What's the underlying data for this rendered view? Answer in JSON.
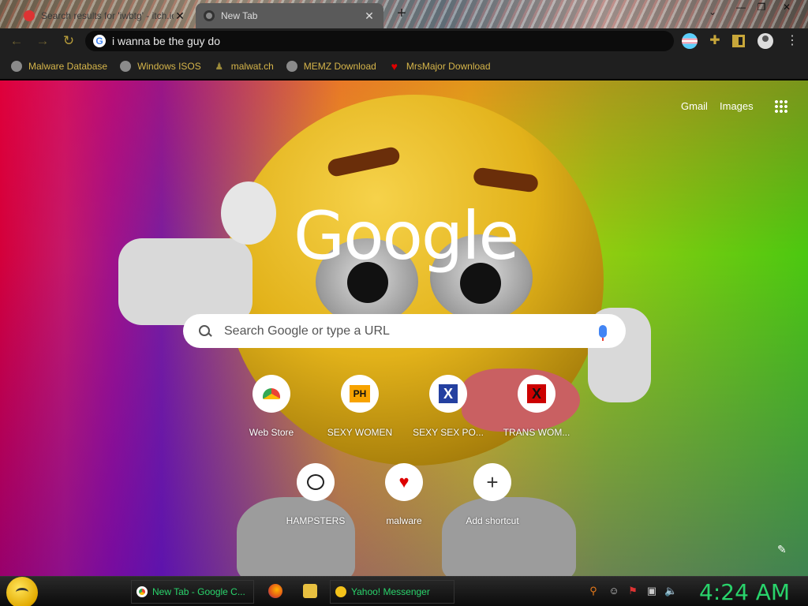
{
  "browser": {
    "tabs": [
      {
        "title": "Search results for 'iwbtg' - itch.io",
        "close": "✕"
      },
      {
        "title": "New Tab",
        "close": "✕"
      }
    ],
    "new_tab_symbol": "+",
    "window_controls": {
      "minimize": "—",
      "restore": "❐",
      "close": "✕"
    },
    "tab_search_symbol": "⌄",
    "toolbar": {
      "back": "←",
      "forward": "→",
      "reload": "↻",
      "address": "i wanna be the guy do",
      "extensions_symbol": "✚",
      "menu_symbol": "⋮"
    },
    "bookmarks": [
      {
        "label": "Malware Database",
        "icon": "globe-icon"
      },
      {
        "label": "Windows ISOS",
        "icon": "globe-icon"
      },
      {
        "label": "malwat.ch",
        "icon": "person-icon"
      },
      {
        "label": "MEMZ Download",
        "icon": "globe-icon"
      },
      {
        "label": "MrsMajor Download",
        "icon": "heart-icon"
      }
    ]
  },
  "ntp": {
    "gmail": "Gmail",
    "images": "Images",
    "logo": "Google",
    "search_placeholder": "Search Google or type a URL",
    "shortcuts": [
      {
        "label": "Web Store",
        "icon": "webstore-icon"
      },
      {
        "label": "SEXY WOMEN",
        "icon": "ph-icon",
        "badge": "PH"
      },
      {
        "label": "SEXY SEX PO...",
        "icon": "x-blue-icon",
        "badge": "X"
      },
      {
        "label": "TRANS WOM...",
        "icon": "x-red-icon",
        "badge": "X"
      },
      {
        "label": "HAMPSTERS",
        "icon": "hamster-icon"
      },
      {
        "label": "malware",
        "icon": "heart-icon",
        "badge": "♥"
      },
      {
        "label": "Add shortcut",
        "icon": "plus-icon",
        "badge": "+"
      }
    ],
    "edit_symbol": "✎"
  },
  "taskbar": {
    "items": [
      {
        "label": "New Tab - Google C...",
        "icon": "chrome-icon"
      },
      {
        "label": "Yahoo! Messenger",
        "icon": "yahoo-messenger-icon"
      }
    ],
    "clock": "4:24 AM"
  },
  "colors": {
    "bookmark_text": "#d6b54a",
    "taskbar_text": "#29d36b",
    "toolbar_bg": "#1f1f1f"
  }
}
